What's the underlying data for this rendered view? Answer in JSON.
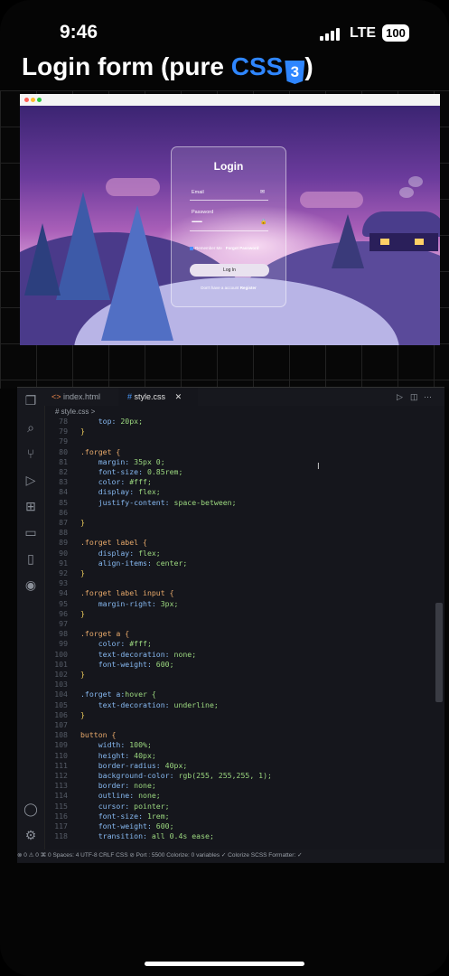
{
  "status_bar": {
    "time": "9:46",
    "network": "LTE",
    "battery": "100"
  },
  "page_title": {
    "prefix": "Login form (pure ",
    "css": "CSS",
    "css3_icon_text": "3",
    "suffix": ")"
  },
  "preview": {
    "login_title": "Login",
    "email_label": "Email",
    "password_label": "Password",
    "password_mask": "••••••••••••",
    "remember_label": "Remember Me",
    "forgot_link": "Forgot Password",
    "login_button": "Log In",
    "register_text": "Don't have a account",
    "register_link": "Register"
  },
  "editor": {
    "tabs": [
      {
        "name": "index.html",
        "icon": "<>"
      },
      {
        "name": "style.css",
        "icon": "#"
      }
    ],
    "breadcrumb": "# style.css > ",
    "lines": [
      {
        "n": "78",
        "t": "    top: 20px;"
      },
      {
        "n": "79",
        "t": "}"
      },
      {
        "n": "79",
        "t": ""
      },
      {
        "n": "80",
        "t": ".forget {"
      },
      {
        "n": "81",
        "t": "    margin: 35px 0;"
      },
      {
        "n": "82",
        "t": "    font-size: 0.85rem;"
      },
      {
        "n": "83",
        "t": "    color: #fff;"
      },
      {
        "n": "84",
        "t": "    display: flex;"
      },
      {
        "n": "85",
        "t": "    justify-content: space-between;"
      },
      {
        "n": "86",
        "t": ""
      },
      {
        "n": "87",
        "t": "}"
      },
      {
        "n": "88",
        "t": ""
      },
      {
        "n": "89",
        "t": ".forget label {"
      },
      {
        "n": "90",
        "t": "    display: flex;"
      },
      {
        "n": "91",
        "t": "    align-items: center;"
      },
      {
        "n": "92",
        "t": "}"
      },
      {
        "n": "93",
        "t": ""
      },
      {
        "n": "94",
        "t": ".forget label input {"
      },
      {
        "n": "95",
        "t": "    margin-right: 3px;"
      },
      {
        "n": "96",
        "t": "}"
      },
      {
        "n": "97",
        "t": ""
      },
      {
        "n": "98",
        "t": ".forget a {"
      },
      {
        "n": "99",
        "t": "    color: #fff;"
      },
      {
        "n": "100",
        "t": "    text-decoration: none;"
      },
      {
        "n": "101",
        "t": "    font-weight: 600;"
      },
      {
        "n": "102",
        "t": "}"
      },
      {
        "n": "103",
        "t": ""
      },
      {
        "n": "104",
        "t": ".forget a:hover {"
      },
      {
        "n": "105",
        "t": "    text-decoration: underline;"
      },
      {
        "n": "106",
        "t": "}"
      },
      {
        "n": "107",
        "t": ""
      },
      {
        "n": "108",
        "t": "button {"
      },
      {
        "n": "109",
        "t": "    width: 100%;"
      },
      {
        "n": "110",
        "t": "    height: 40px;"
      },
      {
        "n": "111",
        "t": "    border-radius: 40px;"
      },
      {
        "n": "112",
        "t": "    background-color: rgb(255, 255,255, 1);"
      },
      {
        "n": "113",
        "t": "    border: none;"
      },
      {
        "n": "114",
        "t": "    outline: none;"
      },
      {
        "n": "115",
        "t": "    cursor: pointer;"
      },
      {
        "n": "116",
        "t": "    font-size: 1rem;"
      },
      {
        "n": "117",
        "t": "    font-weight: 600;"
      },
      {
        "n": "118",
        "t": "    transition: all 0.4s ease;"
      }
    ],
    "status": "⊗ 0 ⚠ 0   ⌘ 0   Spaces: 4   UTF-8   CRLF   CSS   ⊘ Port : 5500   Colorize: 0 variables   ✓ Colorize   SCSS Formatter: ✓"
  }
}
